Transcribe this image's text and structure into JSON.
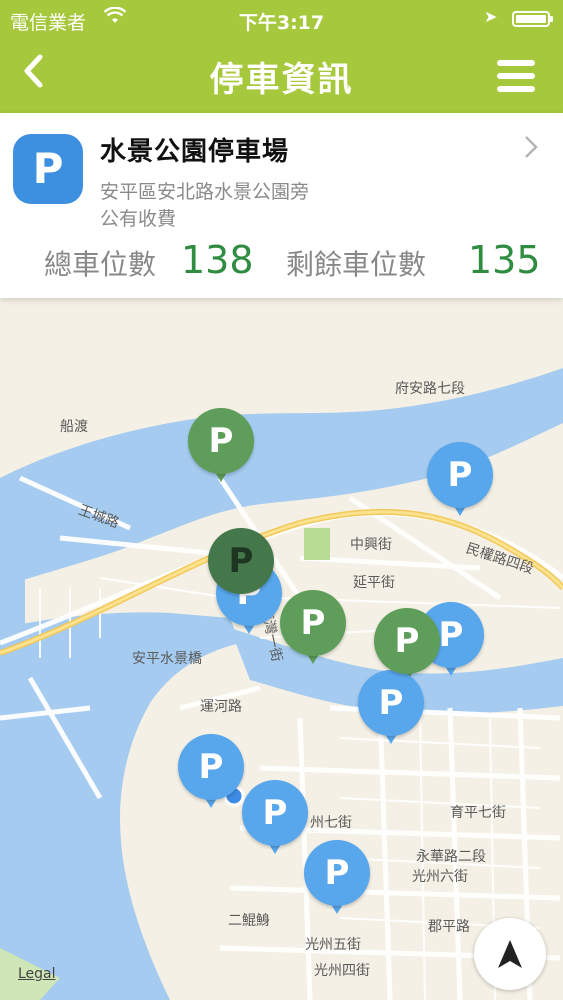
{
  "status_bar": {
    "carrier": "電信業者",
    "time": "下午3:17"
  },
  "nav": {
    "title": "停車資訊"
  },
  "parking": {
    "badge": "P",
    "name": "水景公園停車場",
    "address_line1": "安平區安北路水景公園旁",
    "address_line2": "公有收費",
    "total_label": "總車位數",
    "total_value": "138",
    "remaining_label": "剩餘車位數",
    "remaining_value": "135"
  },
  "colors": {
    "accent": "#a6c83c",
    "value_green": "#2f8c41",
    "pin_blue": "#58a6ec",
    "pin_green": "#5f9e5a",
    "water": "#a5cbf0",
    "land": "#f4f0e5"
  },
  "map": {
    "pin_label": "P",
    "labels": {
      "fuan": "府安路七段",
      "chuandu": "船渡",
      "wangcheng": "王城路",
      "zhongxing": "中興街",
      "yanping": "延平街",
      "minquan": "民權路四段",
      "anping_shuijing": "安平水景橋",
      "yunhe": "運河路",
      "zhanan": "南灣一街",
      "yuhua": "育平七街",
      "yonghua": "永華路二段",
      "guangzhou6": "光州六街",
      "guangzhou5": "光州五街",
      "guangzhou4": "光州四街",
      "erkunshen": "二鯤鯓",
      "junping": "郡平路",
      "zhou7": "州七街"
    },
    "legal": "Legal"
  },
  "icons": {
    "back": "chevron-left-icon",
    "menu": "hamburger-menu-icon",
    "detail": "chevron-right-icon",
    "locate": "location-arrow-icon"
  }
}
